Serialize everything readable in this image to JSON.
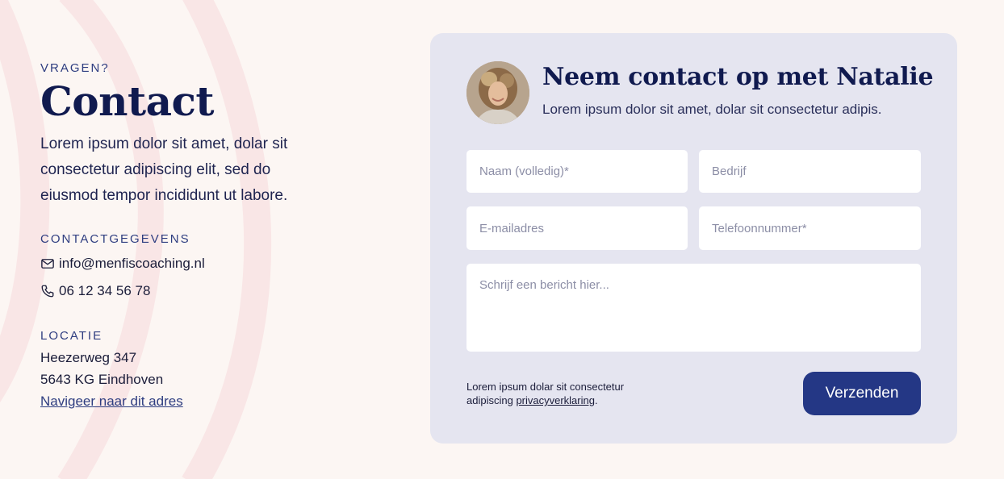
{
  "colors": {
    "background": "#fcf6f3",
    "card": "#e5e5f0",
    "navy": "#101a4f",
    "accent": "#243785",
    "arc": "#f9e6e6"
  },
  "intro": {
    "eyebrow": "VRAGEN?",
    "title": "Contact",
    "text": "Lorem ipsum dolor sit amet, dolar sit consectetur adipiscing elit, sed do eiusmod tempor incididunt ut labore."
  },
  "contact": {
    "heading": "CONTACTGEGEVENS",
    "email_icon": "mail-icon",
    "email": "info@menfiscoaching.nl",
    "phone_icon": "phone-icon",
    "phone": "06 12 34 56 78"
  },
  "location": {
    "heading": "LOCATIE",
    "street": "Heezerweg 347",
    "city": "5643 KG Eindhoven",
    "navigate_link": "Navigeer naar dit adres"
  },
  "form": {
    "title": "Neem contact op met Natalie",
    "subtitle": "Lorem ipsum dolor sit amet, dolar sit consectetur adipis.",
    "fields": {
      "name_placeholder": "Naam (volledig)*",
      "company_placeholder": "Bedrijf",
      "email_placeholder": "E-mailadres",
      "phone_placeholder": "Telefoonnummer*",
      "message_placeholder": "Schrijf een bericht hier..."
    },
    "privacy_text": "Lorem ipsum dolar sit consectetur adipiscing ",
    "privacy_link": "privacyverklaring",
    "privacy_end": ".",
    "submit_label": "Verzenden"
  }
}
